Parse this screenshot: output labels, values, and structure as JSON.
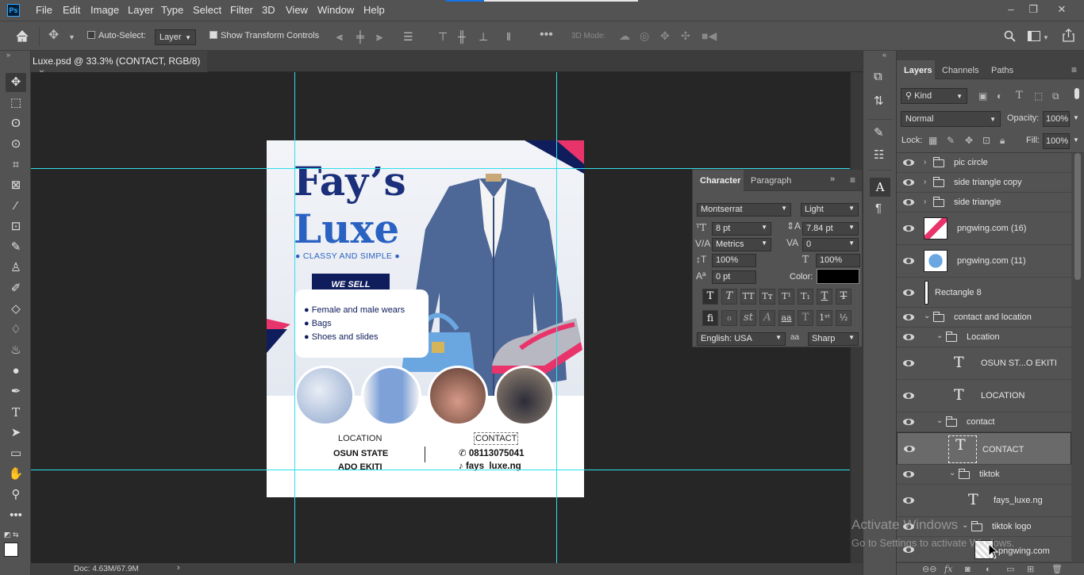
{
  "app": {
    "icon": "Ps"
  },
  "menu": [
    "File",
    "Edit",
    "Image",
    "Layer",
    "Type",
    "Select",
    "Filter",
    "3D",
    "View",
    "Window",
    "Help"
  ],
  "window_controls": {
    "minimize": "–",
    "restore": "❐",
    "close": "✕"
  },
  "options": {
    "auto_select_label": "Auto-Select:",
    "auto_select_value": "Layer",
    "transform_label": "Show Transform Controls",
    "mode3d_label": "3D Mode:"
  },
  "document": {
    "tab_title": "Luxe.psd @ 33.3% (CONTACT, RGB/8)",
    "close": "×",
    "status": "Doc: 4.63M/67.9M"
  },
  "poster": {
    "title_line1": "Fay’s",
    "title_line2": "Luxe",
    "tagline": "CLASSY AND SIMPLE",
    "we_sell": "WE SELL",
    "items": [
      "Female and male wears",
      "Bags",
      "Shoes and slides"
    ],
    "location_heading": "LOCATION",
    "location_line1": "OSUN STATE",
    "location_line2": "ADO EKITI",
    "contact_heading": "CONTACT",
    "phone": "08113075041",
    "handle": "fays_luxe.ng"
  },
  "character_panel": {
    "tabs": [
      "Character",
      "Paragraph"
    ],
    "font_family": "Montserrat",
    "font_style": "Light",
    "font_size": "8 pt",
    "leading": "7.84 pt",
    "kerning": "Metrics",
    "tracking": "0",
    "vertical_scale": "100%",
    "horizontal_scale": "100%",
    "baseline_shift": "0 pt",
    "color_label": "Color:",
    "language": "English: USA",
    "antialias_icon": "aa",
    "antialias": "Sharp",
    "colors": {
      "text_color": "#000000"
    }
  },
  "layers_panel": {
    "tabs": [
      "Layers",
      "Channels",
      "Paths"
    ],
    "filter_kind": "Kind",
    "blend_mode": "Normal",
    "opacity_label": "Opacity:",
    "opacity": "100%",
    "lock_label": "Lock:",
    "fill_label": "Fill:",
    "fill": "100%",
    "rows": [
      {
        "name": "pic circle",
        "kind": "folder",
        "indent": 0,
        "collapsed": true
      },
      {
        "name": "side triangle copy",
        "kind": "folder",
        "indent": 0,
        "collapsed": true
      },
      {
        "name": "side triangle",
        "kind": "folder",
        "indent": 0,
        "collapsed": true
      },
      {
        "name": "pngwing.com (16)",
        "kind": "image",
        "indent": 0
      },
      {
        "name": "pngwing.com (11)",
        "kind": "image",
        "indent": 0
      },
      {
        "name": "Rectangle 8",
        "kind": "shape",
        "indent": 0
      },
      {
        "name": "contact and location",
        "kind": "folder",
        "indent": 0,
        "collapsed": false
      },
      {
        "name": "Location",
        "kind": "folder",
        "indent": 1,
        "collapsed": false
      },
      {
        "name": "OSUN ST...O EKITI",
        "kind": "text",
        "indent": 2
      },
      {
        "name": "LOCATION",
        "kind": "text",
        "indent": 2
      },
      {
        "name": "contact",
        "kind": "folder",
        "indent": 1,
        "collapsed": false
      },
      {
        "name": "CONTACT",
        "kind": "text",
        "indent": 2,
        "selected": true
      },
      {
        "name": "tiktok",
        "kind": "folder",
        "indent": 2,
        "collapsed": false
      },
      {
        "name": "fays_luxe.ng",
        "kind": "text",
        "indent": 3
      },
      {
        "name": "tiktok logo",
        "kind": "folder",
        "indent": 3,
        "collapsed": false
      },
      {
        "name": "pngwing.com",
        "kind": "image",
        "indent": 4
      }
    ]
  },
  "watermark": {
    "line1": "Activate Windows",
    "line2": "Go to Settings to activate Windows."
  },
  "colors": {
    "ui_bg": "#535353",
    "canvas_bg": "#262626",
    "guide": "#2ee0ec",
    "poster_navy": "#0f1d5c",
    "poster_blue": "#1e57b8",
    "poster_pink": "#e8336b"
  }
}
